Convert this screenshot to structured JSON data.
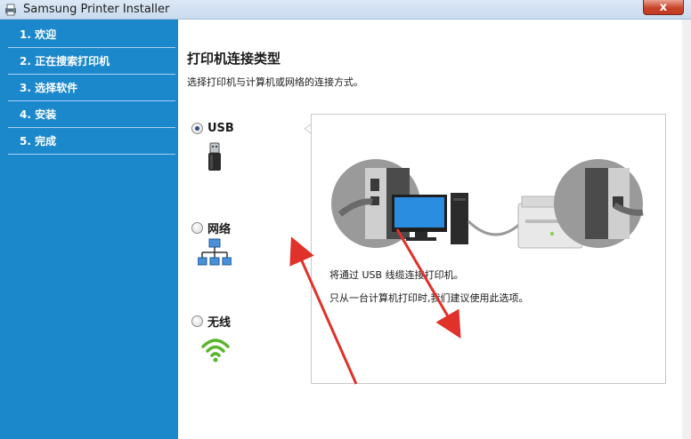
{
  "window": {
    "title": "Samsung Printer Installer",
    "close_glyph": "x"
  },
  "sidebar": {
    "items": [
      {
        "label": "1. 欢迎"
      },
      {
        "label": "2. 正在搜索打印机"
      },
      {
        "label": "3. 选择软件"
      },
      {
        "label": "4. 安装"
      },
      {
        "label": "5. 完成"
      }
    ]
  },
  "main": {
    "heading": "打印机连接类型",
    "subheading": "选择打印机与计算机或网络的连接方式。",
    "options": [
      {
        "label": "USB",
        "checked": true,
        "icon": "usb-icon"
      },
      {
        "label": "网络",
        "checked": false,
        "icon": "network-icon"
      },
      {
        "label": "无线",
        "checked": false,
        "icon": "wireless-icon"
      }
    ],
    "panel": {
      "line1": "将通过 USB 线缆连接打印机。",
      "line2": "只从一台计算机打印时,我们建议使用此选项。"
    }
  },
  "colors": {
    "sidebar_bg": "#1c88cc",
    "annotation_arrow": "#e0312a"
  }
}
